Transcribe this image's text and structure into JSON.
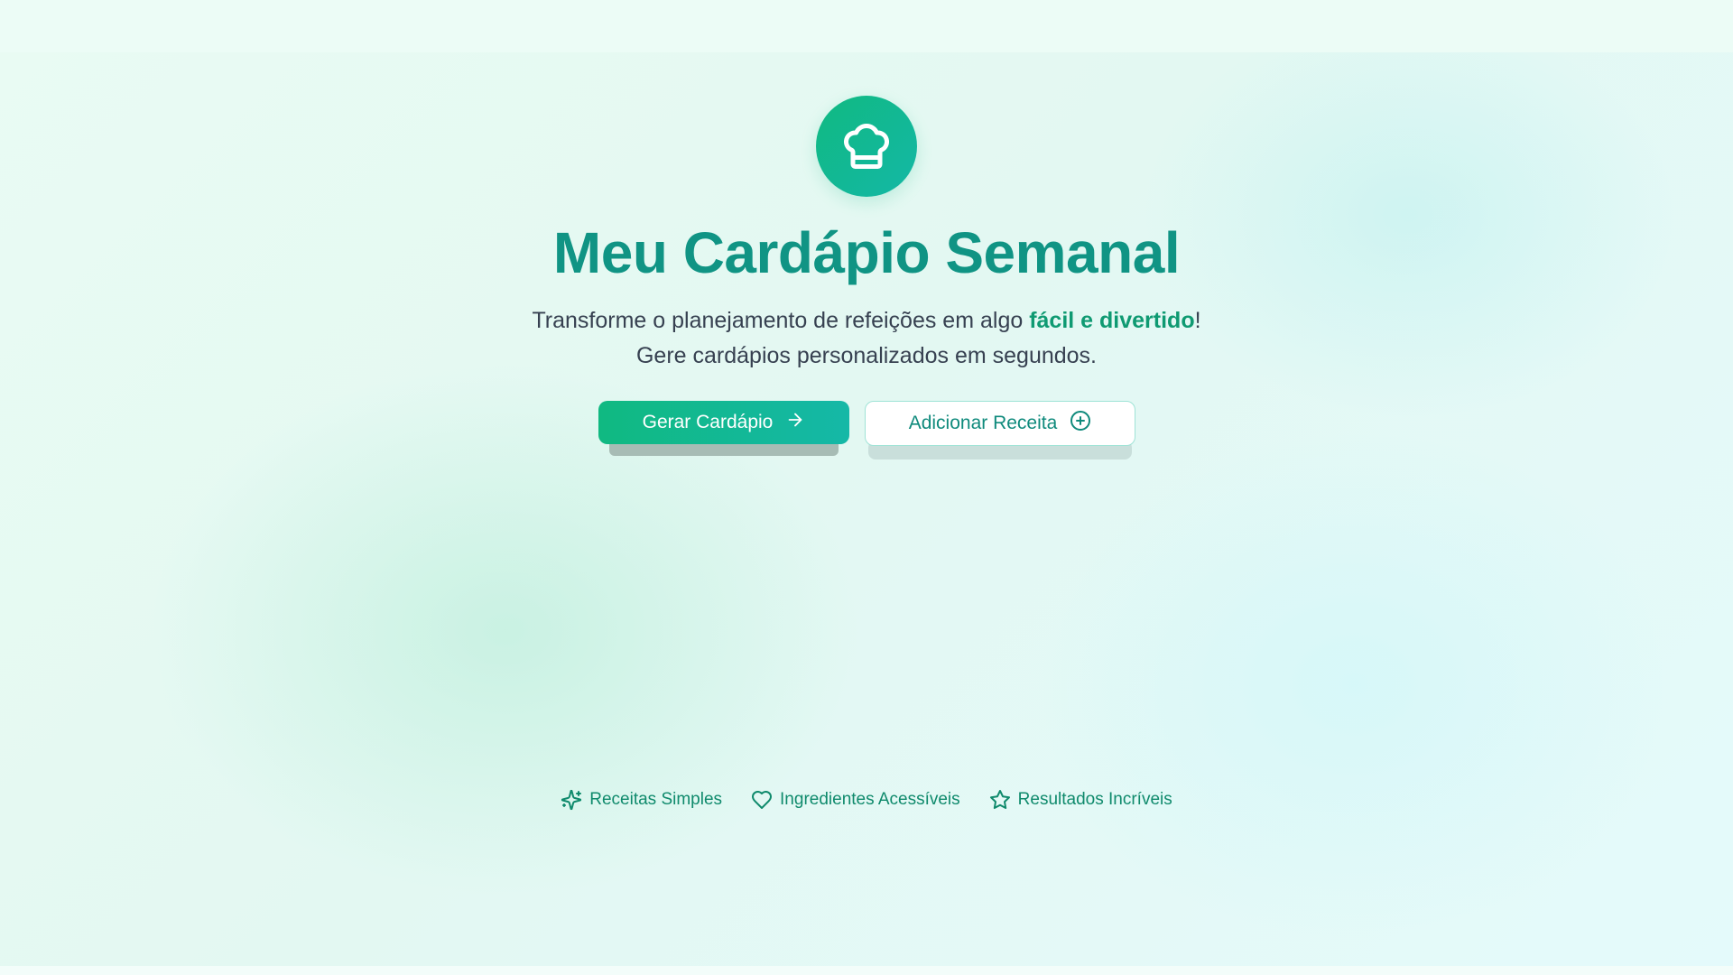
{
  "hero": {
    "logo_icon": "chef-hat-icon",
    "title": "Meu Cardápio Semanal",
    "subtitle_line1_prefix": "Transforme o planejamento de refeições em algo ",
    "subtitle_line1_highlight": "fácil e divertido",
    "subtitle_line1_suffix": "!",
    "subtitle_line2": "Gere cardápios personalizados em segundos."
  },
  "buttons": {
    "primary_label": "Gerar Cardápio",
    "primary_icon": "arrow-right-icon",
    "secondary_label": "Adicionar Receita",
    "secondary_icon": "plus-circle-icon"
  },
  "features": [
    {
      "icon": "sparkles-icon",
      "label": "Receitas Simples"
    },
    {
      "icon": "heart-icon",
      "label": "Ingredientes Acessíveis"
    },
    {
      "icon": "star-icon",
      "label": "Resultados Incríveis"
    }
  ],
  "colors": {
    "brand": "#10b981",
    "brand_teal": "#14b8a6",
    "title": "#109484",
    "highlight": "#0f9a72"
  }
}
